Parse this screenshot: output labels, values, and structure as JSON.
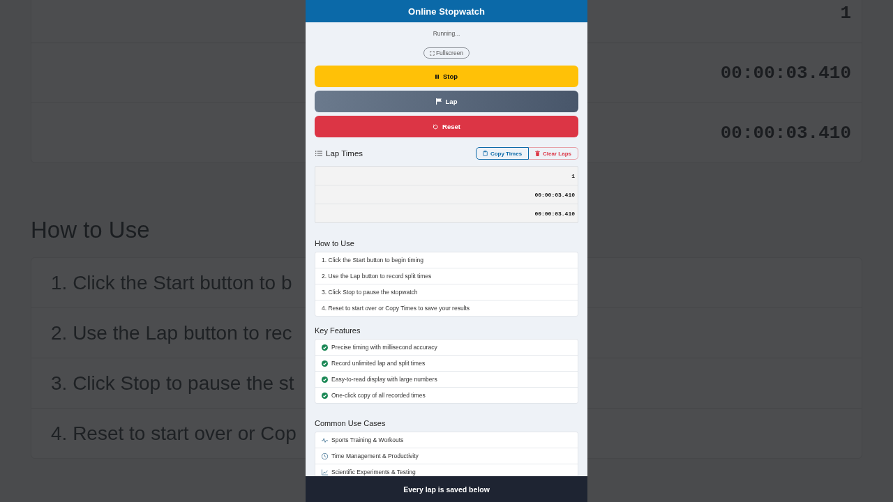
{
  "backdrop": {
    "lap_rows": [
      "1",
      "00:00:03.410",
      "00:00:03.410"
    ],
    "heading": "How to Use",
    "items": [
      "1. Click the Start button to b",
      "2. Use the Lap button to rec",
      "3. Click Stop to pause the st",
      "4. Reset to start over or Cop"
    ]
  },
  "header": {
    "title": "Online Stopwatch"
  },
  "status": "Running...",
  "fullscreen_button": "Fullscreen",
  "controls": [
    {
      "label": "Stop",
      "kind": "stop"
    },
    {
      "label": "Lap",
      "kind": "lap"
    },
    {
      "label": "Reset",
      "kind": "reset"
    }
  ],
  "lap_times": {
    "title": "Lap Times",
    "actions": [
      {
        "label": "Copy Times",
        "kind": "copy"
      },
      {
        "label": "Clear Laps",
        "kind": "clear"
      }
    ],
    "rows": [
      "1",
      "00:00:03.410",
      "00:00:03.410"
    ]
  },
  "sections": [
    {
      "heading": "How to Use",
      "kind": "steps",
      "items": [
        {
          "text": "1. Click the Start button to begin timing"
        },
        {
          "text": "2. Use the Lap button to record split times"
        },
        {
          "text": "3. Click Stop to pause the stopwatch"
        },
        {
          "text": "4. Reset to start over or Copy Times to save your results"
        }
      ]
    },
    {
      "heading": "Key Features",
      "kind": "features",
      "items": [
        {
          "text": "Precise timing with millisecond accuracy"
        },
        {
          "text": "Record unlimited lap and split times"
        },
        {
          "text": "Easy-to-read display with large numbers"
        },
        {
          "text": "One-click copy of all recorded times"
        }
      ]
    },
    {
      "heading": "Common Use Cases",
      "kind": "uses",
      "items": [
        {
          "text": "Sports Training & Workouts",
          "kind": "activity"
        },
        {
          "text": "Time Management & Productivity",
          "kind": "clock"
        },
        {
          "text": "Scientific Experiments & Testing",
          "kind": "chart"
        }
      ]
    }
  ],
  "caption": "Every lap is saved below"
}
